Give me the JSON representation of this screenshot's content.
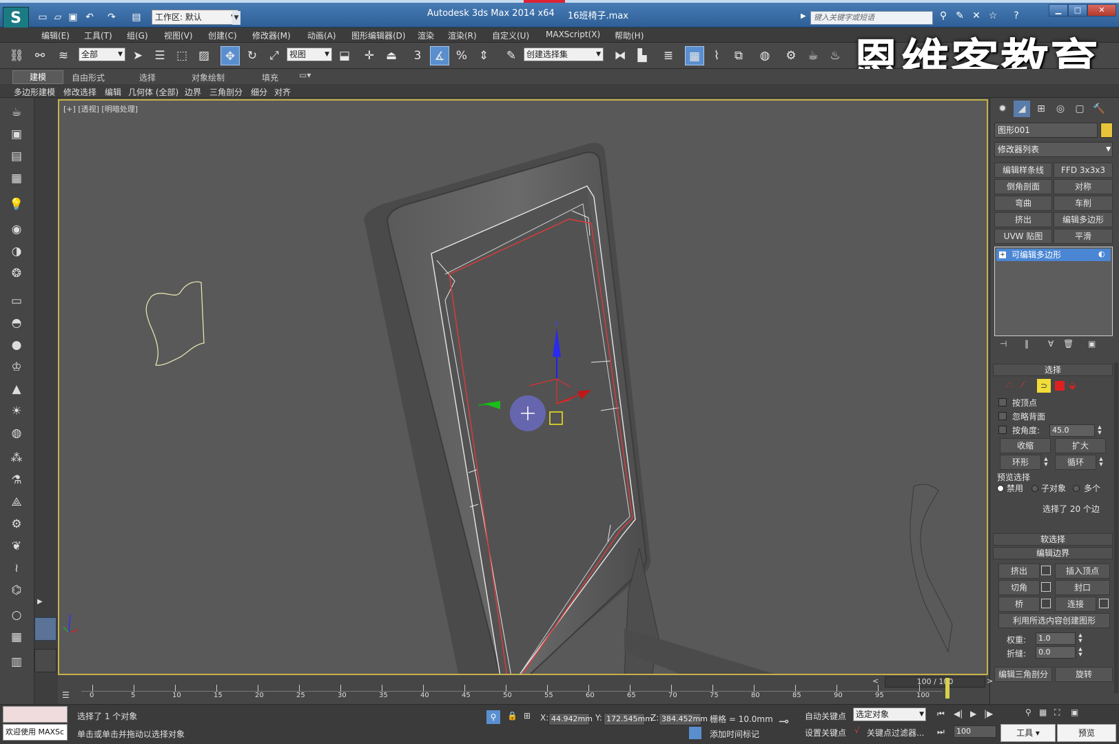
{
  "titlebar": {
    "workspace_label": "工作区: 默认",
    "app_title": "Autodesk 3ds Max  2014 x64",
    "file_name": "16班椅子.max",
    "search_placeholder": "键入关键字或短语"
  },
  "menu": [
    "编辑(E)",
    "工具(T)",
    "组(G)",
    "视图(V)",
    "创建(C)",
    "修改器(M)",
    "动画(A)",
    "图形编辑器(D)",
    "渲染",
    "渲染(R)",
    "自定义(U)",
    "MAXScript(X)",
    "帮助(H)"
  ],
  "toolbar": {
    "filter_value": "全部",
    "coord_system": "视图",
    "selection_set": "创建选择集",
    "snap_label": "3",
    "percent_label": "%"
  },
  "watermark": "恩维客教育",
  "ribbon": {
    "tabs": [
      "建模",
      "自由形式",
      "选择",
      "对象绘制",
      "填充"
    ],
    "subtabs": [
      "多边形建模",
      "修改选择",
      "编辑",
      "几何体 (全部)",
      "边界",
      "三角剖分",
      "细分",
      "对齐"
    ]
  },
  "viewport": {
    "label_plus": "[+]",
    "label_view": "[透视]",
    "label_shading": "[明暗处理]",
    "gizmo_z": "z"
  },
  "command_panel": {
    "object_name": "图形001",
    "modifier_list": "修改器列表",
    "modifier_buttons": [
      "编辑样条线",
      "FFD 3x3x3",
      "倒角剖面",
      "对称",
      "弯曲",
      "车削",
      "挤出",
      "编辑多边形",
      "UVW 贴图",
      "平滑"
    ],
    "stack_item": "可编辑多边形",
    "selection_rollout": "选择",
    "by_vertex": "按顶点",
    "ignore_backface": "忽略背面",
    "by_angle": "按角度:",
    "by_angle_value": "45.0",
    "shrink": "收缩",
    "grow": "扩大",
    "ring": "环形",
    "loop": "循环",
    "preview_selection": "预览选择",
    "preview_options": [
      "禁用",
      "子对象",
      "多个"
    ],
    "selected_info": "选择了 20 个边",
    "soft_selection": "软选择",
    "edit_borders": "编辑边界",
    "extrude": "挤出",
    "insert_vertex": "插入顶点",
    "chamfer": "切角",
    "cap": "封口",
    "bridge": "桥",
    "connect": "连接",
    "create_shape": "利用所选内容创建图形",
    "weight_label": "权重:",
    "weight_value": "1.0",
    "crease_label": "折缝:",
    "crease_value": "0.0",
    "edit_tri": "编辑三角剖分",
    "turn": "旋转"
  },
  "timeline": {
    "frame_display": "100 / 100",
    "ticks": [
      "0",
      "5",
      "10",
      "15",
      "20",
      "25",
      "30",
      "35",
      "40",
      "45",
      "50",
      "55",
      "60",
      "65",
      "70",
      "75",
      "80",
      "85",
      "90",
      "95",
      "100"
    ]
  },
  "statusbar": {
    "welcome": "欢迎使用 MAXSc",
    "selected_count": "选择了 1 个对象",
    "hint": "单击或单击并拖动以选择对象",
    "x_label": "X:",
    "x_value": "44.942mm",
    "y_label": "Y:",
    "y_value": "172.545mm",
    "z_label": "Z:",
    "z_value": "384.452mm",
    "grid": "栅格 = 10.0mm",
    "add_time_tag": "添加时间标记",
    "auto_key": "自动关键点",
    "set_key": "设置关键点",
    "key_mode_select": "选定对象",
    "key_filters": "关键点过滤器...",
    "current_frame": "100",
    "tools": "工具",
    "preview": "预览"
  },
  "colors": {
    "title_bg": "#3a6aa4",
    "viewport_bg": "#595959",
    "viewport_border": "#c7b24a",
    "active_blue": "#5a8fcf",
    "stack_highlight": "#4a86d4"
  }
}
